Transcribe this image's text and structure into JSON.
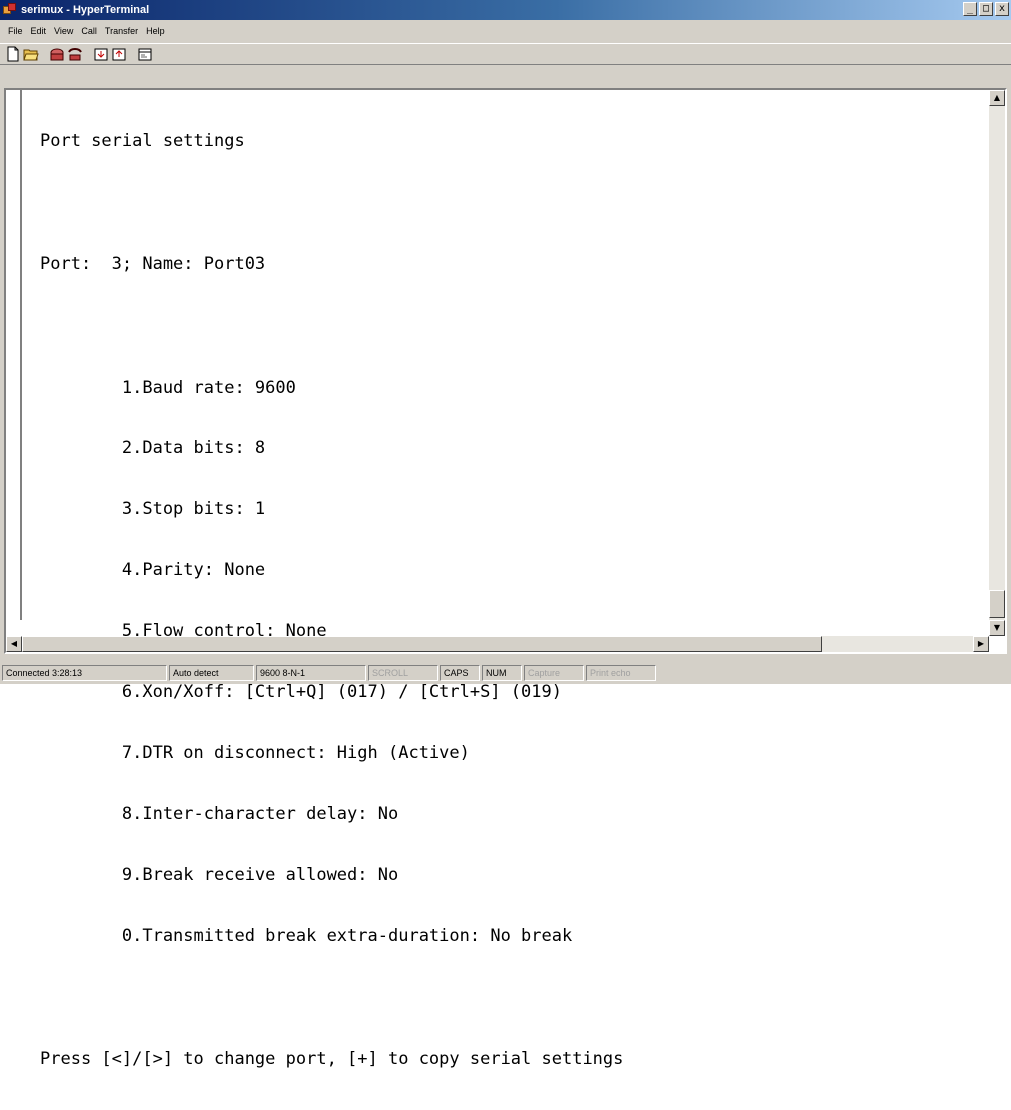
{
  "window": {
    "title": "serimux - HyperTerminal",
    "controls": [
      "_",
      "□",
      "x"
    ]
  },
  "menu": [
    "File",
    "Edit",
    "View",
    "Call",
    "Transfer",
    "Help"
  ],
  "toolbar": {
    "buttons": [
      "new-connection-icon",
      "open-icon",
      "call-icon",
      "disconnect-icon",
      "send-icon",
      "receive-icon",
      "properties-icon"
    ]
  },
  "terminal": {
    "lines": [
      "Port serial settings",
      "",
      "Port:  3; Name: Port03",
      "",
      "        1.Baud rate: 9600",
      "        2.Data bits: 8",
      "        3.Stop bits: 1",
      "        4.Parity: None",
      "        5.Flow control: None",
      "        6.Xon/Xoff: [Ctrl+Q] (017) / [Ctrl+S] (019)",
      "        7.DTR on disconnect: High (Active)",
      "        8.Inter-character delay: No",
      "        9.Break receive allowed: No",
      "        0.Transmitted break extra-duration: No break",
      "",
      "Press [<]/[>] to change port, [+] to copy serial settings"
    ]
  },
  "statusbar": {
    "connected": "Connected 3:28:13",
    "detect": "Auto detect",
    "params": "9600 8-N-1",
    "scroll": "SCROLL",
    "caps": "CAPS",
    "num": "NUM",
    "capture": "Capture",
    "print_echo": "Print echo"
  }
}
